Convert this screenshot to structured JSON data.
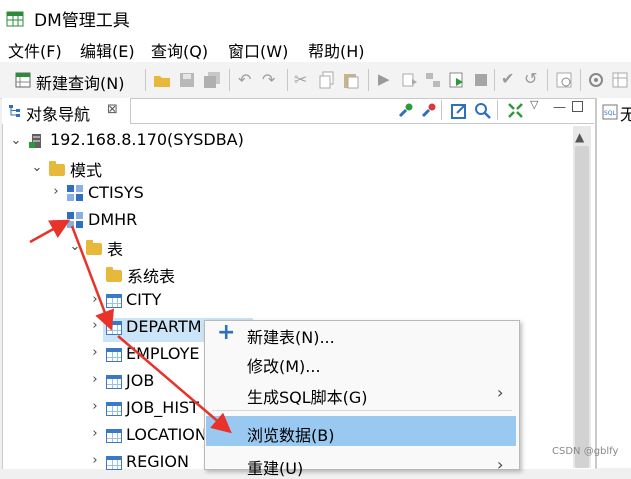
{
  "window": {
    "title": "DM管理工具"
  },
  "menu": [
    "文件(F)",
    "编辑(E)",
    "查询(Q)",
    "窗口(W)",
    "帮助(H)"
  ],
  "toolbar": {
    "new_query_label": "新建查询(N)"
  },
  "navigator": {
    "tab_title": "对象导航",
    "tab_close": "⊠",
    "right_tab_text": "无"
  },
  "tree": {
    "server": "192.168.8.170(SYSDBA)",
    "schemas_folder": "模式",
    "schema_ctisys": "CTISYS",
    "schema_dmhr": "DMHR",
    "tables_folder": "表",
    "system_tables": "系统表",
    "tables": [
      "CITY",
      "DEPARTM",
      "EMPLOYE",
      "JOB",
      "JOB_HIST",
      "LOCATION",
      "REGION"
    ]
  },
  "context_menu": {
    "new_table": "新建表(N)...",
    "modify": "修改(M)...",
    "gen_sql": "生成SQL脚本(G)",
    "browse_data": "浏览数据(B)",
    "rebuild": "重建(U)"
  },
  "watermark": "CSDN @gblfy",
  "colors": {
    "accent": "#2f6fc0",
    "highlight": "#99c9f1",
    "arrow": "#e8322a"
  }
}
